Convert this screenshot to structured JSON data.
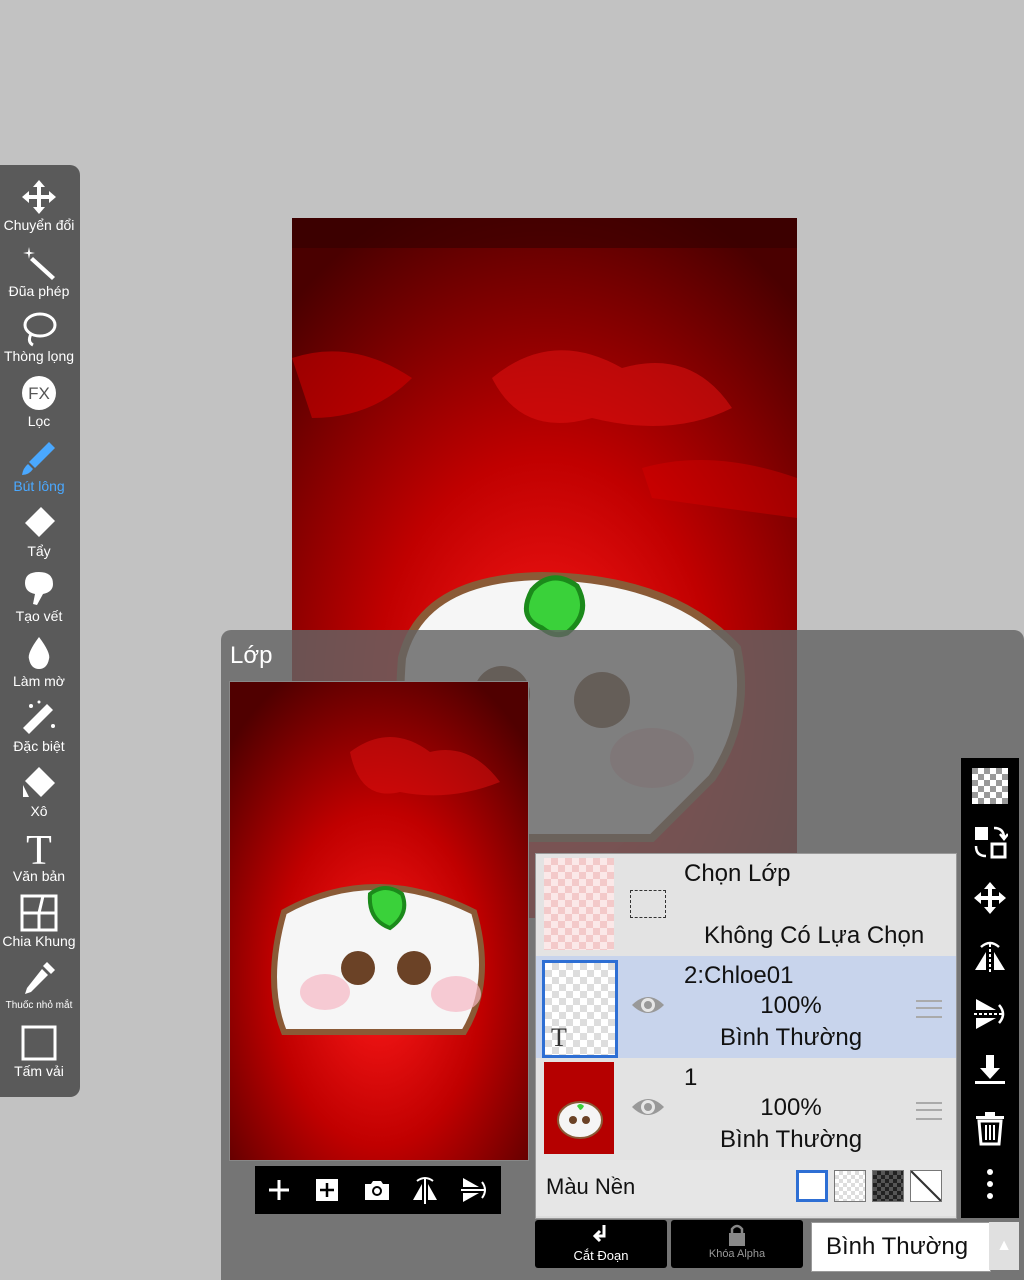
{
  "toolbar": {
    "items": [
      {
        "label": "Chuyển đổi",
        "icon": "move-arrows-icon"
      },
      {
        "label": "Đũa phép",
        "icon": "magic-wand-icon"
      },
      {
        "label": "Thòng lọng",
        "icon": "lasso-icon"
      },
      {
        "label": "Lọc",
        "icon": "fx-icon",
        "glyph": "FX"
      },
      {
        "label": "Bút lông",
        "icon": "brush-icon",
        "active": true
      },
      {
        "label": "Tẩy",
        "icon": "eraser-icon"
      },
      {
        "label": "Tạo vết",
        "icon": "smudge-icon"
      },
      {
        "label": "Làm mờ",
        "icon": "blur-drop-icon"
      },
      {
        "label": "Đặc biệt",
        "icon": "special-wand-icon"
      },
      {
        "label": "Xô",
        "icon": "bucket-icon"
      },
      {
        "label": "Văn bản",
        "icon": "text-icon",
        "glyph": "T"
      },
      {
        "label": "Chia Khung",
        "icon": "frame-divide-icon"
      },
      {
        "label": "Thuốc nhỏ mắt",
        "icon": "eyedropper-icon"
      },
      {
        "label": "Tấm vải",
        "icon": "canvas-icon"
      }
    ]
  },
  "panel": {
    "title": "Lớp",
    "selection_row": {
      "title": "Chọn Lớp",
      "status": "Không Có Lựa Chọn"
    },
    "layers": [
      {
        "name": "2:Chloe01",
        "opacity": "100%",
        "mode": "Bình Thường",
        "selected": true,
        "type_glyph": "T"
      },
      {
        "name": "1",
        "opacity": "100%",
        "mode": "Bình Thường",
        "selected": false
      }
    ],
    "background": {
      "label": "Màu Nền"
    },
    "bottom": {
      "clip_label": "Cắt Đoạn",
      "alpha_label": "Khóa Alpha",
      "blend_mode": "Bình Thường",
      "arrow": "▲"
    }
  },
  "colors": {
    "accent": "#4aa8ff",
    "selection_blue": "#2e6fd4",
    "canvas_red": "#b00000"
  }
}
